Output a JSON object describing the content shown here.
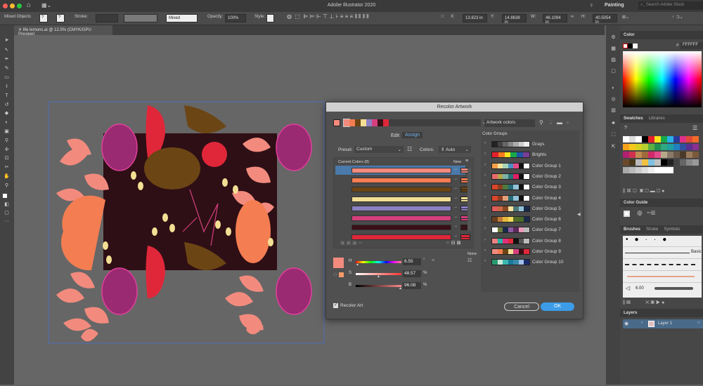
{
  "app_title": "Adobe Illustrator 2020",
  "workspace": "Painting",
  "search_placeholder": "Search Adobe Stock",
  "control": {
    "selection": "Mixed Objects",
    "stroke_label": "Stroke:",
    "stroke_style": "Mixed",
    "opacity_label": "Opacity:",
    "opacity": "100%",
    "style_label": "Style:",
    "x_label": "X:",
    "x": "13.823 in",
    "y_label": "Y:",
    "y": "14.8638 in",
    "w_label": "W:",
    "w": "46.1094 in",
    "h_label": "H:",
    "h": "40.5054 in"
  },
  "document_tab": "life lemons.ai @ 12.5% (CMYK/GPU Preview)",
  "recolor": {
    "title": "Recolor Artwork",
    "artwork_colors": "Artwork colors",
    "tabs": [
      "Edit",
      "Assign"
    ],
    "active_tab": "Assign",
    "preset_label": "Preset:",
    "preset": "Custom",
    "colors_label": "Colors:",
    "colors": "Auto",
    "current_colors_label": "Current Colors (8)",
    "new_label": "New",
    "none_label": "None",
    "current_colors": [
      "#f28b7e",
      "#f47d52",
      "#6b4514",
      "#f3df94",
      "#8c80c4",
      "#d53f7d",
      "#3a0f16",
      "#e0273a"
    ],
    "color_groups_label": "Color Groups",
    "color_groups": [
      {
        "name": "Grays",
        "colors": [
          "#222",
          "#444",
          "#666",
          "#888",
          "#aaa",
          "#ccc",
          "#eee"
        ]
      },
      {
        "name": "Brights",
        "colors": [
          "#e3202b",
          "#f47a1f",
          "#f7e51b",
          "#17a84a",
          "#1f57a7",
          "#7a3d97"
        ]
      },
      {
        "name": "Color Group 1",
        "colors": [
          "#f5a04a",
          "#f0e39a",
          "#a9d3b8",
          "#4b8fc2",
          "#e34a8a",
          "#111",
          "#fff"
        ]
      },
      {
        "name": "Color Group 2",
        "colors": [
          "#ea6a6a",
          "#b5a84a",
          "#7fb1a6",
          "#27727a",
          "#e01f64",
          "#111",
          "#fff"
        ]
      },
      {
        "name": "Color Group 3",
        "colors": [
          "#d9452a",
          "#8b3f22",
          "#4e7a3d",
          "#256b77",
          "#93c1d8",
          "#111",
          "#fff"
        ]
      },
      {
        "name": "Color Group 4",
        "colors": [
          "#d9452a",
          "#8b3f22",
          "#e3a07a",
          "#256b77",
          "#93c1d8",
          "#111",
          "#fff"
        ]
      },
      {
        "name": "Color Group 5",
        "colors": [
          "#e25a5a",
          "#c96a44",
          "#8a4a24",
          "#f4e0a0",
          "#4f7a7a",
          "#93c1d8",
          "#1a2a4a"
        ]
      },
      {
        "name": "Color Group 6",
        "colors": [
          "#6b4020",
          "#c07a3a",
          "#e8b83a",
          "#f2dc5a",
          "#556b2a",
          "#4a6a2a",
          "#1a2a4a"
        ]
      },
      {
        "name": "Color Group 7",
        "colors": [
          "#fff",
          "#6b7a3a",
          "#1a2a4a",
          "#8a5aa0",
          "#5a2a5a",
          "#e89ab8",
          "#bbb"
        ]
      },
      {
        "name": "Color Group 8",
        "colors": [
          "#f08080",
          "#2ab0a8",
          "#e0307a",
          "#e02a3a",
          "#111",
          "#555",
          "#bbb"
        ]
      },
      {
        "name": "Color Group 9",
        "colors": [
          "#f28b7e",
          "#f47d52",
          "#6b4514",
          "#f3df94",
          "#d53f7d",
          "#3a0f16",
          "#e0273a"
        ]
      },
      {
        "name": "Color Group 10",
        "colors": [
          "#2a9a70",
          "#c8e8d8",
          "#3ab8b0",
          "#1a7a9a",
          "#3a8aaa",
          "#a0c0e8",
          "#1a2a6a"
        ]
      }
    ],
    "h_label": "H",
    "h": "6.55",
    "h_unit": "°",
    "s_label": "S",
    "s": "48.57",
    "s_unit": "%",
    "b_label": "B",
    "b": "96.08",
    "b_unit": "%",
    "selected_color": "#f28b7e",
    "recolor_art_label": "Recolor Art",
    "recolor_art_checked": true,
    "cancel": "Cancel",
    "ok": "OK"
  },
  "panels": {
    "color_tab": "Color",
    "hex": "FFFFFF",
    "swatches_tab": "Swatches",
    "libraries_tab": "Libraries",
    "color_guide_tab": "Color Guide",
    "brushes_tab": "Brushes",
    "stroke_tab": "Stroke",
    "symbols_tab": "Symbols",
    "brush_basic": "Basic",
    "brush_size": "6.00",
    "layers_tab": "Layers",
    "layer_name": "Layer 1"
  }
}
